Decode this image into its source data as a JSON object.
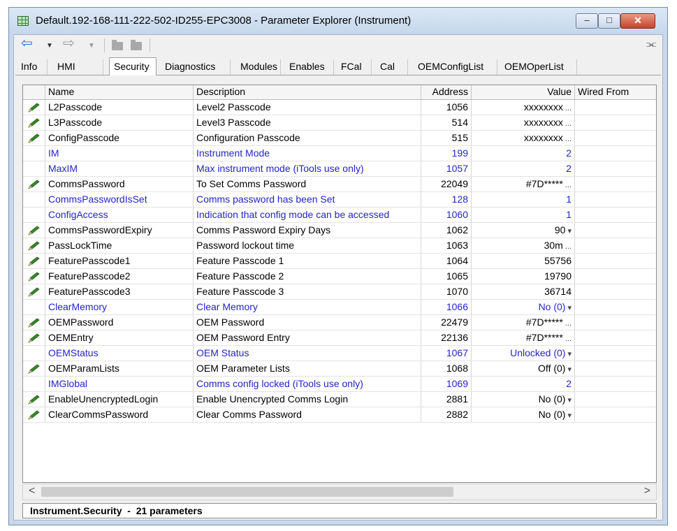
{
  "window": {
    "title": "Default.192-168-111-222-502-ID255-EPC3008 - Parameter Explorer (Instrument)",
    "minimize_glyph": "–",
    "maximize_glyph": "□",
    "close_glyph": "✕"
  },
  "toolbar": {
    "back_glyph": "⇦",
    "forward_glyph": "⇨",
    "dropdown_glyph": "▼",
    "pin_glyph": "⫘"
  },
  "tabs": [
    {
      "label": "Info"
    },
    {
      "label": "HMI"
    },
    {
      "label": "Security",
      "active": true
    },
    {
      "label": "Diagnostics"
    },
    {
      "label": "Modules"
    },
    {
      "label": "Enables"
    },
    {
      "label": "FCal"
    },
    {
      "label": "Cal"
    },
    {
      "label": "OEMConfigList"
    },
    {
      "label": "OEMOperList"
    }
  ],
  "grid": {
    "headers": {
      "name": "Name",
      "description": "Description",
      "address": "Address",
      "value": "Value",
      "wired_from": "Wired From"
    },
    "rows": [
      {
        "editable": true,
        "blue": false,
        "name": "L2Passcode",
        "description": "Level2 Passcode",
        "address": "1056",
        "value": "xxxxxxxx",
        "ctrl": "..."
      },
      {
        "editable": true,
        "blue": false,
        "name": "L3Passcode",
        "description": "Level3 Passcode",
        "address": "514",
        "value": "xxxxxxxx",
        "ctrl": "..."
      },
      {
        "editable": true,
        "blue": false,
        "name": "ConfigPasscode",
        "description": "Configuration Passcode",
        "address": "515",
        "value": "xxxxxxxx",
        "ctrl": "..."
      },
      {
        "editable": false,
        "blue": true,
        "name": "IM",
        "description": "Instrument Mode",
        "address": "199",
        "value": "2",
        "ctrl": ""
      },
      {
        "editable": false,
        "blue": true,
        "name": "MaxIM",
        "description": "Max instrument mode (iTools use only)",
        "address": "1057",
        "value": "2",
        "ctrl": ""
      },
      {
        "editable": true,
        "blue": false,
        "name": "CommsPassword",
        "description": "To Set Comms Password",
        "address": "22049",
        "value": "#7D*****",
        "ctrl": "..."
      },
      {
        "editable": false,
        "blue": true,
        "name": "CommsPasswordIsSet",
        "description": "Comms password has been Set",
        "address": "128",
        "value": "1",
        "ctrl": ""
      },
      {
        "editable": false,
        "blue": true,
        "name": "ConfigAccess",
        "description": "Indication that config mode can be accessed",
        "address": "1060",
        "value": "1",
        "ctrl": ""
      },
      {
        "editable": true,
        "blue": false,
        "name": "CommsPasswordExpiry",
        "description": "Comms Password Expiry Days",
        "address": "1062",
        "value": "90",
        "ctrl": "▾"
      },
      {
        "editable": true,
        "blue": false,
        "name": "PassLockTime",
        "description": "Password lockout time",
        "address": "1063",
        "value": "30m",
        "ctrl": "..."
      },
      {
        "editable": true,
        "blue": false,
        "name": "FeaturePasscode1",
        "description": "Feature Passcode 1",
        "address": "1064",
        "value": "55756",
        "ctrl": ""
      },
      {
        "editable": true,
        "blue": false,
        "name": "FeaturePasscode2",
        "description": "Feature Passcode 2",
        "address": "1065",
        "value": "19790",
        "ctrl": ""
      },
      {
        "editable": true,
        "blue": false,
        "name": "FeaturePasscode3",
        "description": "Feature Passcode 3",
        "address": "1070",
        "value": "36714",
        "ctrl": ""
      },
      {
        "editable": false,
        "blue": true,
        "name": "ClearMemory",
        "description": "Clear Memory",
        "address": "1066",
        "value": "No (0)",
        "ctrl": "▾"
      },
      {
        "editable": true,
        "blue": false,
        "name": "OEMPassword",
        "description": "OEM Password",
        "address": "22479",
        "value": "#7D*****",
        "ctrl": "..."
      },
      {
        "editable": true,
        "blue": false,
        "name": "OEMEntry",
        "description": "OEM Password Entry",
        "address": "22136",
        "value": "#7D*****",
        "ctrl": "..."
      },
      {
        "editable": false,
        "blue": true,
        "name": "OEMStatus",
        "description": "OEM Status",
        "address": "1067",
        "value": "Unlocked (0)",
        "ctrl": "▾"
      },
      {
        "editable": true,
        "blue": false,
        "name": "OEMParamLists",
        "description": "OEM Parameter Lists",
        "address": "1068",
        "value": "Off (0)",
        "ctrl": "▾"
      },
      {
        "editable": false,
        "blue": true,
        "name": "IMGlobal",
        "description": "Comms config locked (iTools use only)",
        "address": "1069",
        "value": "2",
        "ctrl": ""
      },
      {
        "editable": true,
        "blue": false,
        "name": "EnableUnencryptedLogin",
        "description": "Enable Unencrypted Comms Login",
        "address": "2881",
        "value": "No (0)",
        "ctrl": "▾"
      },
      {
        "editable": true,
        "blue": false,
        "name": "ClearCommsPassword",
        "description": "Clear Comms Password",
        "address": "2882",
        "value": "No (0)",
        "ctrl": "▾"
      }
    ]
  },
  "scrollbar": {
    "left_glyph": "<",
    "right_glyph": ">"
  },
  "status": {
    "text": "Instrument.Security  -  21 parameters"
  },
  "colors": {
    "blue_row_text": "#2424c8",
    "pencil": "#3a8a2a"
  }
}
